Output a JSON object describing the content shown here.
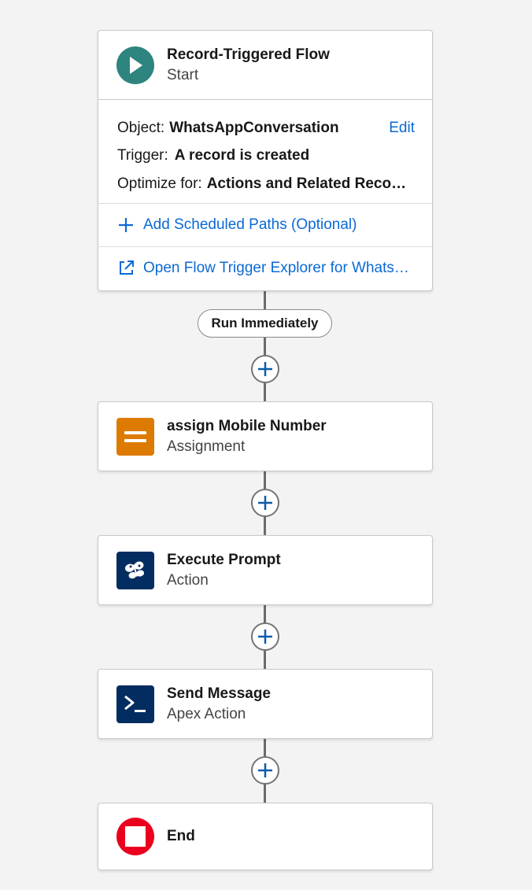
{
  "start": {
    "title": "Record-Triggered Flow",
    "subtitle": "Start",
    "icon": "play-icon",
    "object_label": "Object:",
    "object_value": "WhatsAppConversation",
    "edit_label": "Edit",
    "trigger_label": "Trigger:",
    "trigger_value": "A record is created",
    "optimize_label": "Optimize for:",
    "optimize_value": "Actions and Related Records",
    "add_paths_label": "Add Scheduled Paths (Optional)",
    "explorer_label": "Open Flow Trigger Explorer for WhatsAppConversation"
  },
  "path_label": "Run Immediately",
  "nodes": [
    {
      "title": "assign Mobile Number",
      "subtitle": "Assignment",
      "icon": "assignment-icon",
      "color": "#dd7a01"
    },
    {
      "title": "Execute Prompt",
      "subtitle": "Action",
      "icon": "butterfly-icon",
      "color": "#032d60"
    },
    {
      "title": "Send Message",
      "subtitle": "Apex Action",
      "icon": "apex-icon",
      "color": "#032d60"
    }
  ],
  "end": {
    "title": "End",
    "icon": "stop-icon",
    "color": "#ea001e"
  },
  "colors": {
    "start_icon": "#2e847e",
    "link": "#0b69d4",
    "plus": "#0b5cab"
  }
}
